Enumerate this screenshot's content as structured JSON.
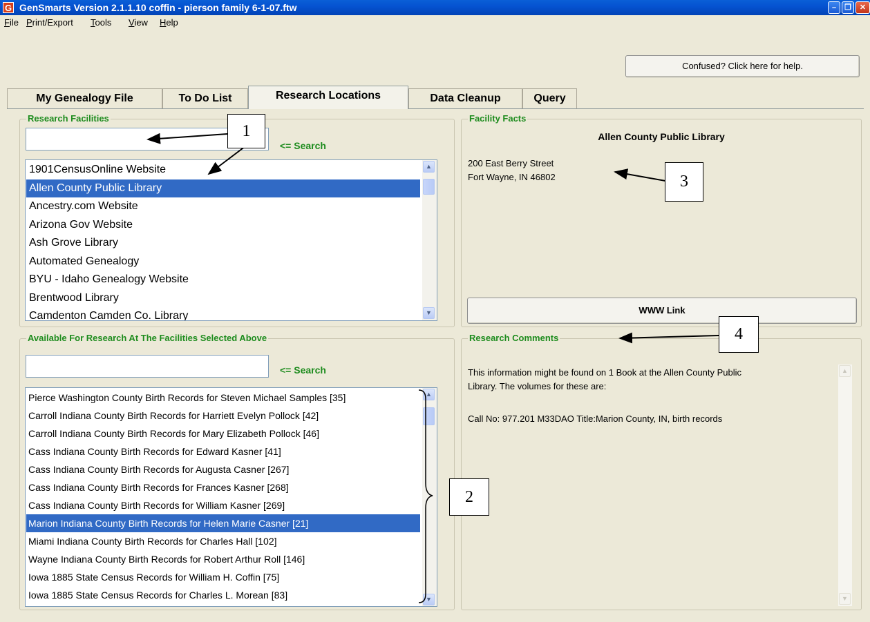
{
  "window": {
    "title": "GenSmarts Version 2.1.1.10 coffin - pierson family 6-1-07.ftw",
    "app_icon_letter": "G",
    "minimize_glyph": "–",
    "maximize_glyph": "❐",
    "close_glyph": "✕"
  },
  "menu": [
    {
      "underlined": "F",
      "rest": "ile"
    },
    {
      "underlined": "P",
      "rest": "rint/Export"
    },
    {
      "underlined": "T",
      "rest": "ools"
    },
    {
      "underlined": "V",
      "rest": "iew"
    },
    {
      "underlined": "H",
      "rest": "elp"
    }
  ],
  "help_button": "Confused? Click here for help.",
  "tabs": [
    "My Genealogy File",
    "To Do List",
    "Research Locations",
    "Data Cleanup",
    "Query"
  ],
  "active_tab": "Research Locations",
  "research_facilities": {
    "title": "Research Facilities",
    "search_value": "",
    "search_hint": "<= Search",
    "items": [
      "1901CensusOnline Website",
      "Allen County Public Library",
      "Ancestry.com Website",
      "Arizona Gov Website",
      "Ash Grove Library",
      "Automated Genealogy",
      "BYU - Idaho Genealogy Website",
      "Brentwood Library",
      "Camdenton Camden Co. Library"
    ],
    "selected_index": 1
  },
  "available": {
    "title": "Available For Research At The Facilities Selected Above",
    "search_value": "",
    "search_hint": "<= Search",
    "items": [
      "Pierce Washington County Birth Records for Steven Michael Samples [35]",
      "Carroll Indiana County Birth Records for Harriett Evelyn Pollock [42]",
      "Carroll Indiana County Birth Records for Mary Elizabeth Pollock [46]",
      "Cass Indiana County Birth Records for Edward Kasner [41]",
      "Cass Indiana County Birth Records for Augusta Casner [267]",
      "Cass Indiana County Birth Records for Frances Kasner [268]",
      "Cass Indiana County Birth Records for William Kasner [269]",
      "Marion Indiana County Birth Records for Helen Marie Casner [21]",
      "Miami Indiana County Birth Records for Charles Hall [102]",
      "Wayne Indiana County Birth Records for Robert Arthur Roll [146]",
      "Iowa 1885 State Census Records for William H. Coffin [75]",
      "Iowa 1885 State Census Records for Charles L. Morean [83]"
    ],
    "selected_index": 7
  },
  "facility_facts": {
    "title": "Facility Facts",
    "name": "Allen County Public Library",
    "address_line1": "200 East Berry Street",
    "address_line2": "Fort Wayne, IN  46802",
    "www_button": "WWW Link"
  },
  "research_comments": {
    "title": "Research Comments",
    "line1": "This information might be found on 1 Book at the Allen County Public",
    "line2": "Library. The volumes for these are:",
    "line3": "Call No: 977.201 M33DAO  Title:Marion County, IN, birth records"
  },
  "callouts": [
    "1",
    "2",
    "3",
    "4"
  ],
  "colors": {
    "selection": "#316AC5",
    "group_title": "#1E8C1E",
    "title_bar": "#0553D1",
    "background": "#ECE9D8"
  }
}
